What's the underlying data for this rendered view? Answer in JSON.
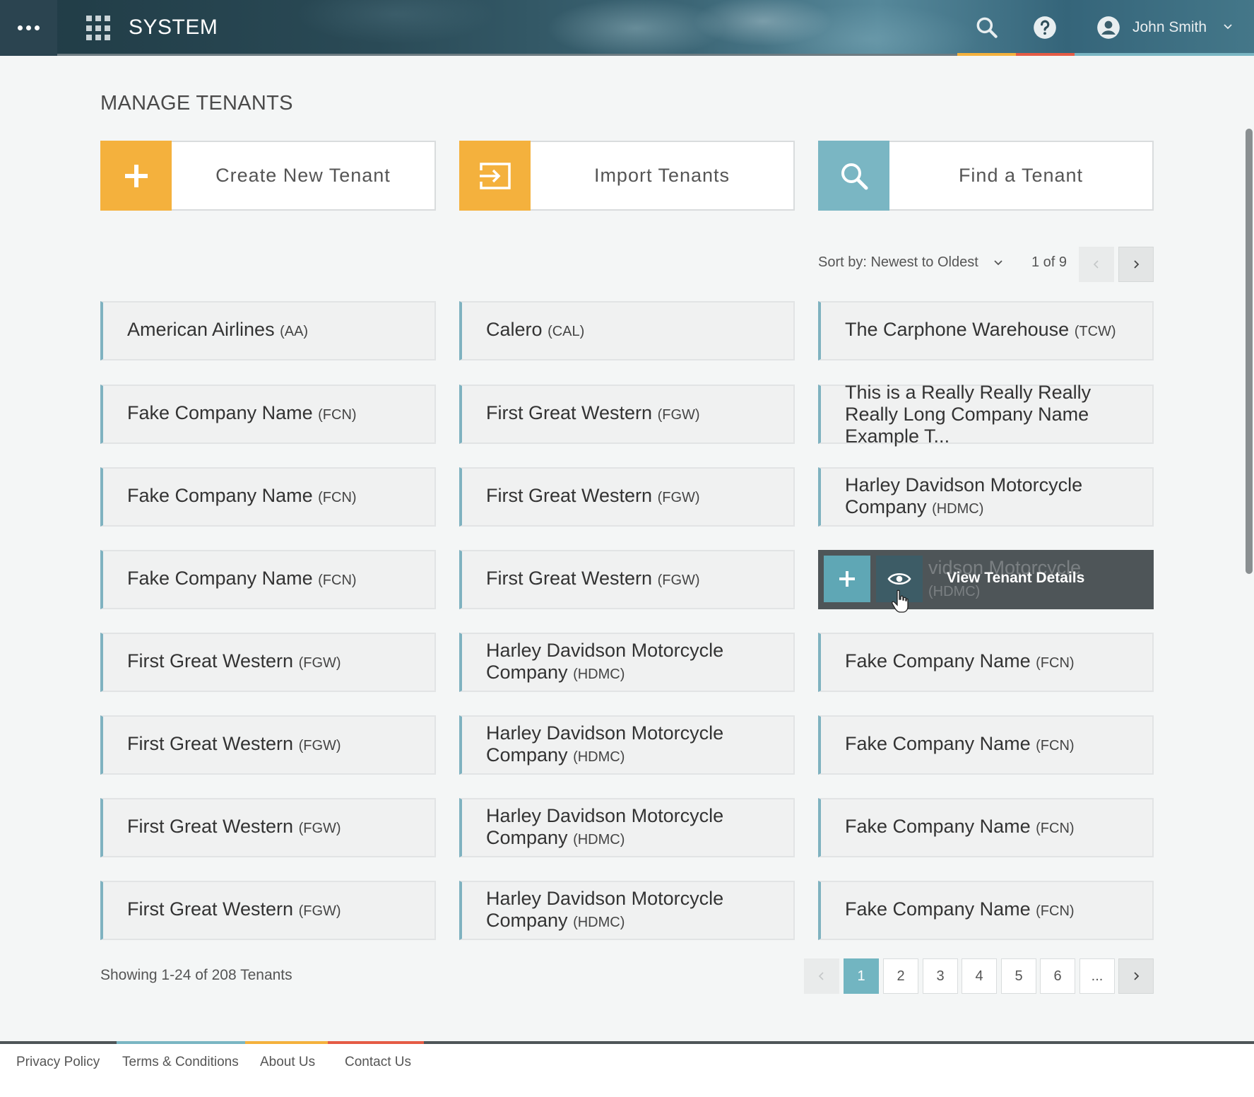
{
  "header": {
    "app_title": "SYSTEM",
    "user_name": "John Smith",
    "icons": {
      "menu": "more-dots-icon",
      "apps": "app-grid-icon",
      "search": "search-icon",
      "help": "help-icon",
      "user": "account-circle-icon",
      "caret": "chevron-down-icon"
    },
    "accent_colors": [
      "#f4b13d",
      "#e55b45",
      "#7ab6c3"
    ]
  },
  "page": {
    "title": "MANAGE TENANTS"
  },
  "actions": [
    {
      "label": "Create New Tenant",
      "icon": "plus-icon",
      "color": "#f4b13d"
    },
    {
      "label": "Import Tenants",
      "icon": "import-icon",
      "color": "#f4b13d"
    },
    {
      "label": "Find a Tenant",
      "icon": "search-icon",
      "color": "#7ab6c3"
    }
  ],
  "toolbar": {
    "sort_label": "Sort by: Newest to Oldest",
    "page_count": "1 of 9"
  },
  "tenants": [
    {
      "name": "American Airlines",
      "abbr": "(AA)"
    },
    {
      "name": "Calero",
      "abbr": "(CAL)"
    },
    {
      "name": "The Carphone Warehouse",
      "abbr": "(TCW)"
    },
    {
      "name": "Fake Company Name",
      "abbr": "(FCN)"
    },
    {
      "name": "First Great Western",
      "abbr": "(FGW)"
    },
    {
      "name": "This is a Really Really Really Really Long Company Name Example T...",
      "abbr": ""
    },
    {
      "name": "Fake Company Name",
      "abbr": "(FCN)"
    },
    {
      "name": "First Great Western",
      "abbr": "(FGW)"
    },
    {
      "name": "Harley Davidson Motorcycle Company",
      "abbr": "(HDMC)"
    },
    {
      "name": "Fake Company Name",
      "abbr": "(FCN)"
    },
    {
      "name": "First Great Western",
      "abbr": "(FGW)"
    },
    {
      "name": "Harley Davidson Motorcycle Company",
      "abbr": "(HDMC)",
      "hovered": true
    },
    {
      "name": "First Great Western",
      "abbr": "(FGW)"
    },
    {
      "name": "Harley Davidson Motorcycle Company",
      "abbr": "(HDMC)"
    },
    {
      "name": "Fake Company Name",
      "abbr": "(FCN)"
    },
    {
      "name": "First Great Western",
      "abbr": "(FGW)"
    },
    {
      "name": "Harley Davidson Motorcycle Company",
      "abbr": "(HDMC)"
    },
    {
      "name": "Fake Company Name",
      "abbr": "(FCN)"
    },
    {
      "name": "First Great Western",
      "abbr": "(FGW)"
    },
    {
      "name": "Harley Davidson Motorcycle Company",
      "abbr": "(HDMC)"
    },
    {
      "name": "Fake Company Name",
      "abbr": "(FCN)"
    },
    {
      "name": "First Great Western",
      "abbr": "(FGW)"
    },
    {
      "name": "Harley Davidson Motorcycle Company",
      "abbr": "(HDMC)"
    },
    {
      "name": "Fake Company Name",
      "abbr": "(FCN)"
    }
  ],
  "hover_overlay": {
    "label": "View Tenant Details",
    "ghost_line1": "vidson Motorcycle",
    "ghost_abbr": "(HDMC)",
    "add_icon": "plus-icon",
    "view_icon": "eye-icon",
    "cursor_icon": "hand-pointer-icon"
  },
  "pagination": {
    "showing_text": "Showing 1-24 of 208 Tenants",
    "pages": [
      "1",
      "2",
      "3",
      "4",
      "5",
      "6",
      "..."
    ],
    "active_page": "1",
    "prev_icon": "chevron-left-icon",
    "next_icon": "chevron-right-icon"
  },
  "footer": {
    "links": [
      "Privacy Policy",
      "Terms & Conditions",
      "About Us",
      "Contact Us"
    ],
    "accent_colors": [
      "#7ab6c3",
      "#f4b13d",
      "#e55b45"
    ]
  }
}
